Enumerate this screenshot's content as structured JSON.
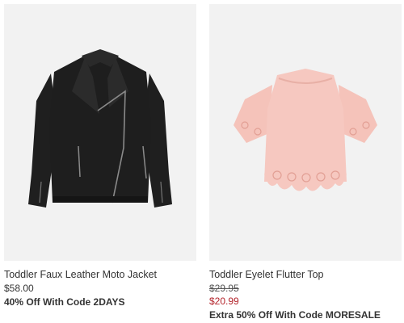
{
  "products": [
    {
      "name": "Toddler Faux Leather Moto Jacket",
      "price": "$58.00",
      "promo": "40% Off With Code 2DAYS",
      "image_icon": "black-moto-jacket-image"
    },
    {
      "name": "Toddler Eyelet Flutter Top",
      "original_price": "$29.95",
      "sale_price": "$20.99",
      "promo": "Extra 50% Off With Code MORESALE",
      "image_icon": "pink-eyelet-top-image"
    }
  ],
  "colors": {
    "image_background": "#f2f2f2",
    "sale_price": "#b3232a",
    "jacket": "#1e1e1e",
    "top": "#f6c8c0"
  }
}
